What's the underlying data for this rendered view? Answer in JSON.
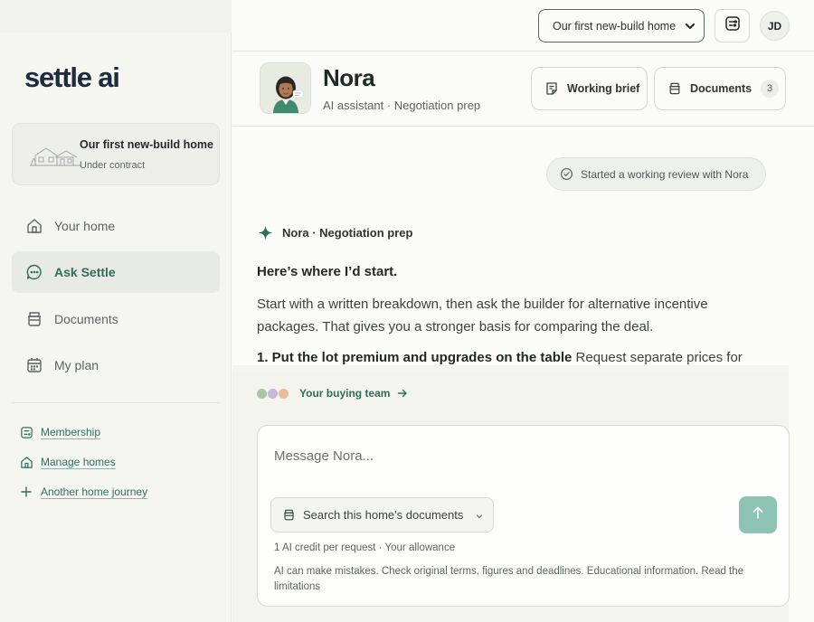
{
  "brand": {
    "logo_text": "settle ai"
  },
  "sidebar": {
    "home_card": {
      "title": "Our first new-build home",
      "subtitle": "Under contract"
    },
    "nav": [
      {
        "label": "Your home",
        "icon": "house-icon",
        "active": false
      },
      {
        "label": "Ask Settle",
        "icon": "chat-icon",
        "active": true
      },
      {
        "label": "Documents",
        "icon": "stack-icon",
        "active": false
      },
      {
        "label": "My plan",
        "icon": "calendar-icon",
        "active": false
      }
    ],
    "links": [
      {
        "label": "Membership",
        "icon": "card-icon"
      },
      {
        "label": "Manage homes",
        "icon": "house-icon"
      },
      {
        "label": "Another home journey",
        "icon": "plus-icon"
      }
    ]
  },
  "topbar": {
    "home_select": {
      "selected": "Our first new-build home"
    },
    "user_initials": "JD"
  },
  "assistant": {
    "name": "Nora",
    "role": "AI assistant · Negotiation prep",
    "working_brief_label": "Working brief",
    "documents_label": "Documents",
    "documents_count": "3"
  },
  "chat": {
    "status": "Started a working review with Nora",
    "speaker": "Nora · Negotiation prep",
    "heading": "Here’s where I’d start.",
    "paragraph": "Start with a written breakdown, then ask the builder for alternative incentive packages. That gives you a stronger basis for comparing the deal.",
    "point_bold": "1. Put the lot premium and upgrades on the table",
    "point_text": " Request separate prices for",
    "team_label": "Your buying team"
  },
  "composer": {
    "placeholder": "Message Nora...",
    "value": "",
    "doc_search_label": "Search this home's documents",
    "credit_note": "1 AI credit per request · Your allowance",
    "disclaimer": "AI can make mistakes. Check original terms, figures and deadlines. Educational information. Read the limitations"
  },
  "colors": {
    "accent": "#2f6e5d",
    "send_button": "#8cc3b3",
    "team_dots": [
      "#a9c7a3",
      "#c6b7dc",
      "#e6bf95"
    ]
  }
}
